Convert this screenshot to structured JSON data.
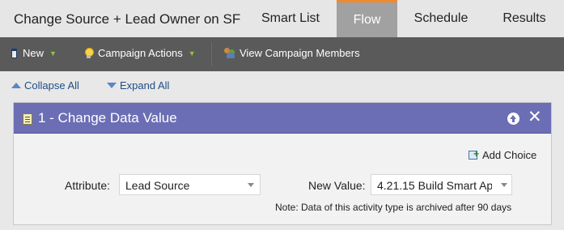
{
  "tabbar": {
    "program_title": "Change Source + Lead Owner on SF",
    "tabs": [
      {
        "label": "Smart List"
      },
      {
        "label": "Flow",
        "active": true
      },
      {
        "label": "Schedule"
      },
      {
        "label": "Results"
      }
    ],
    "active_tab_accent": "#f08a2c"
  },
  "toolbar": {
    "new_label": "New",
    "campaign_actions_label": "Campaign Actions",
    "view_members_label": "View Campaign Members",
    "icons": [
      "phone-icon",
      "lightbulb-icon",
      "people-icon"
    ]
  },
  "flow_controls": {
    "collapse_label": "Collapse All",
    "expand_label": "Expand All"
  },
  "step": {
    "title": "1 - Change Data Value",
    "header_color": "#6b6eb4",
    "add_choice_label": "Add Choice",
    "attribute_label": "Attribute:",
    "attribute_value": "Lead Source",
    "new_value_label": "New Value:",
    "new_value_value": "4.21.15 Build Smart Ap",
    "note": "Note: Data of this activity type is archived after 90 days"
  }
}
